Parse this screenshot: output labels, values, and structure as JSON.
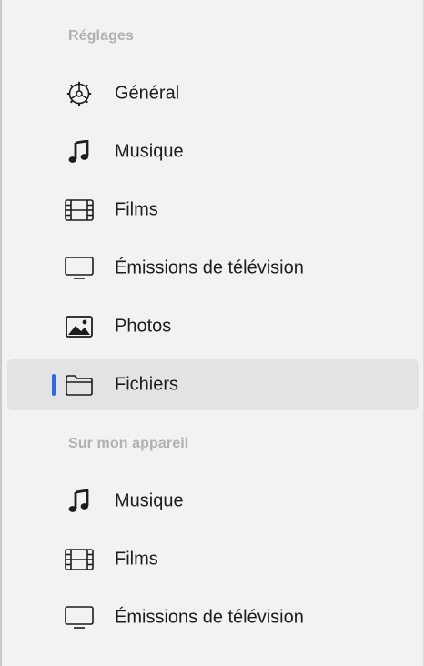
{
  "sidebar": {
    "sections": [
      {
        "title": "Réglages",
        "items": [
          {
            "label": "Général",
            "icon": "gear-icon"
          },
          {
            "label": "Musique",
            "icon": "music-note-icon"
          },
          {
            "label": "Films",
            "icon": "film-icon"
          },
          {
            "label": "Émissions de télévision",
            "icon": "tv-icon"
          },
          {
            "label": "Photos",
            "icon": "photo-icon"
          },
          {
            "label": "Fichiers",
            "icon": "folder-icon",
            "selected": true
          }
        ]
      },
      {
        "title": "Sur mon appareil",
        "items": [
          {
            "label": "Musique",
            "icon": "music-note-icon"
          },
          {
            "label": "Films",
            "icon": "film-icon"
          },
          {
            "label": "Émissions de télévision",
            "icon": "tv-icon"
          }
        ]
      }
    ],
    "accent_color": "#2f6be6"
  }
}
